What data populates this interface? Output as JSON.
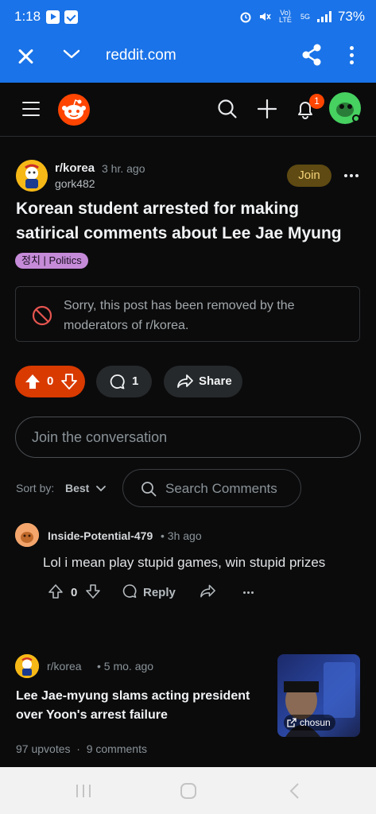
{
  "status_bar": {
    "time": "1:18",
    "network": "Vo) LTE",
    "net5g": "5G",
    "battery": "73%"
  },
  "browser_bar": {
    "url": "reddit.com"
  },
  "header": {
    "notification_count": "1"
  },
  "post": {
    "subreddit": "r/korea",
    "time": "3 hr. ago",
    "author": "gork482",
    "join_label": "Join",
    "title": "Korean student arrested for making satirical comments about Lee Jae Myung",
    "flair": "정치 | Politics",
    "removed_notice": "Sorry, this post has been removed by the moderators of r/korea.",
    "votes": "0",
    "comments": "1",
    "share_label": "Share"
  },
  "join_conversation_placeholder": "Join the conversation",
  "sort": {
    "label": "Sort by:",
    "value": "Best"
  },
  "search_comments_placeholder": "Search Comments",
  "comment": {
    "author": "Inside-Potential-479",
    "time": "• 3h ago",
    "body": "Lol i mean play stupid games, win stupid prizes",
    "votes": "0",
    "reply_label": "Reply"
  },
  "related": {
    "subreddit": "r/korea",
    "time": "• 5 mo. ago",
    "title": "Lee Jae-myung slams acting president over Yoon's arrest failure",
    "thumb_source": "chosun",
    "stats": "97 upvotes  ·  9 comments"
  },
  "colors": {
    "brand": "#ff4500",
    "chrome_blue": "#1a73e8",
    "flair": "#c58bd8"
  }
}
